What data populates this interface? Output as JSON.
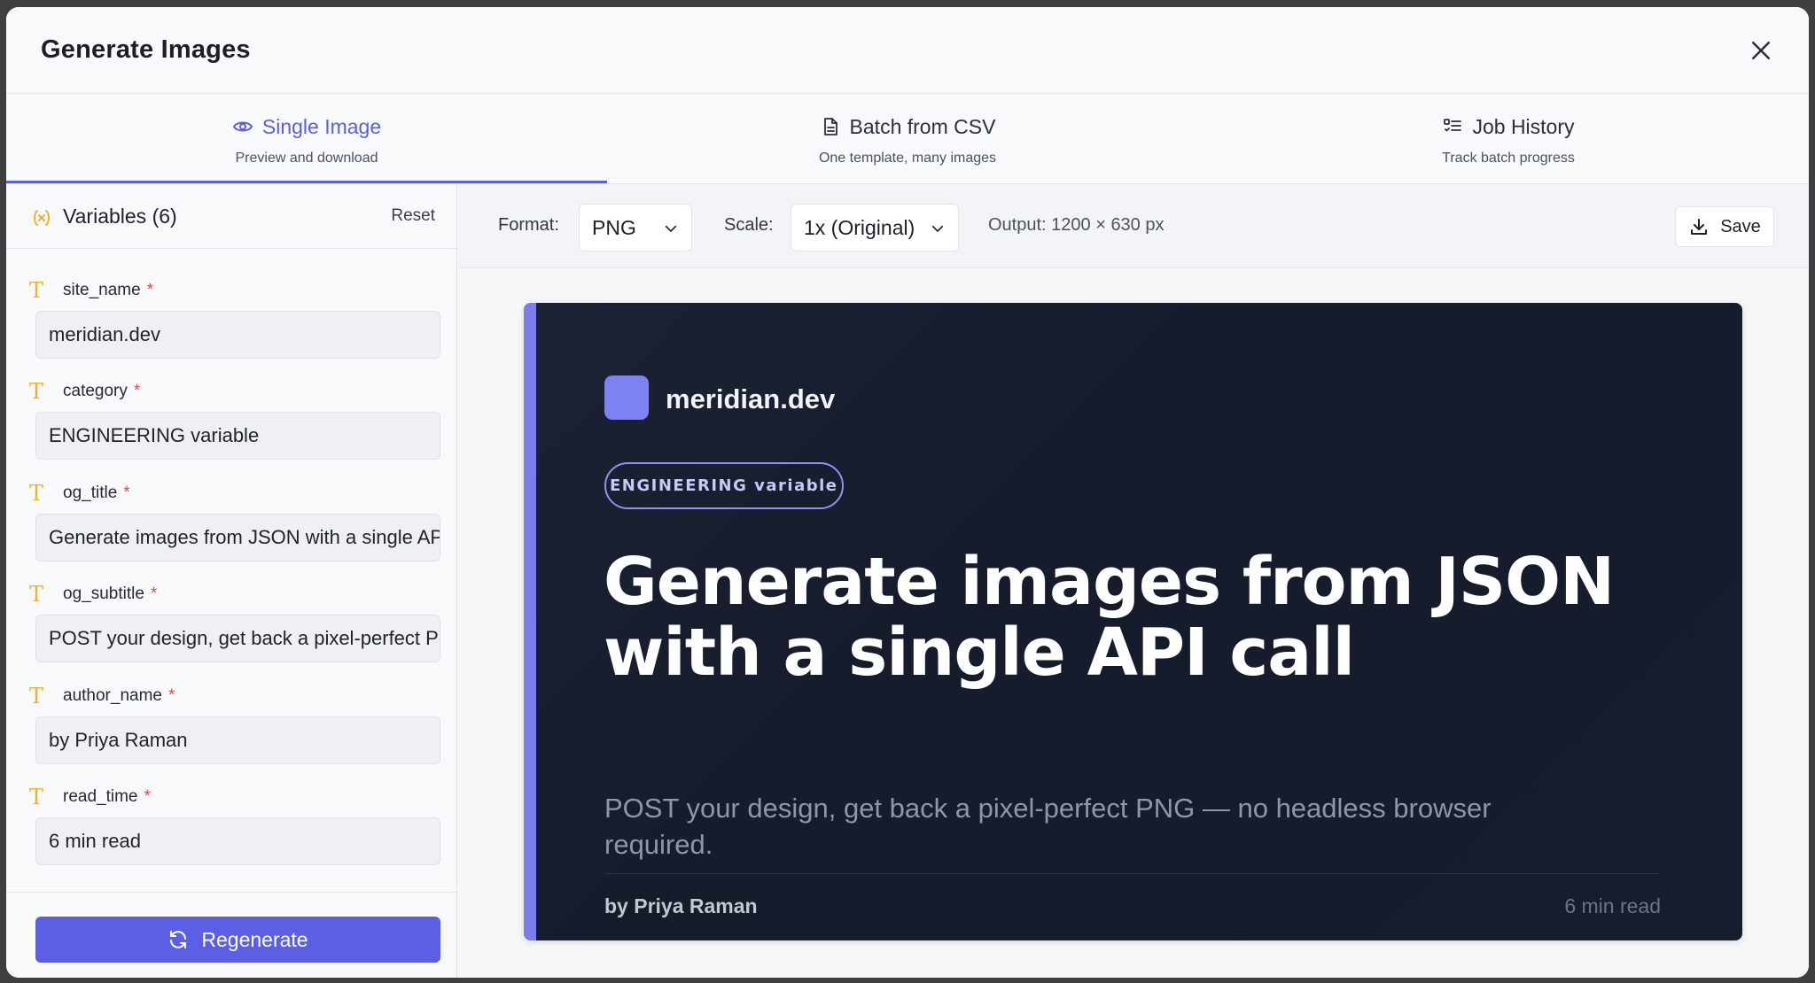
{
  "modal": {
    "title": "Generate Images"
  },
  "tabs": [
    {
      "label": "Single Image",
      "sub": "Preview and download",
      "icon": "eye-icon",
      "active": true
    },
    {
      "label": "Batch from CSV",
      "sub": "One template, many images",
      "icon": "file-icon",
      "active": false
    },
    {
      "label": "Job History",
      "sub": "Track batch progress",
      "icon": "list-checks-icon",
      "active": false
    }
  ],
  "sidebar": {
    "title": "Variables (6)",
    "reset_label": "Reset",
    "fields": [
      {
        "name": "site_name",
        "required": "*",
        "value": "meridian.dev"
      },
      {
        "name": "category",
        "required": "*",
        "value": "ENGINEERING variable"
      },
      {
        "name": "og_title",
        "required": "*",
        "value": "Generate images from JSON with a single API call"
      },
      {
        "name": "og_subtitle",
        "required": "*",
        "value": "POST your design, get back a pixel-perfect PNG — no headless browser required."
      },
      {
        "name": "author_name",
        "required": "*",
        "value": "by Priya Raman"
      },
      {
        "name": "read_time",
        "required": "*",
        "value": "6 min read"
      }
    ],
    "regenerate_label": "Regenerate"
  },
  "toolbar": {
    "format_label": "Format:",
    "format_value": "PNG",
    "scale_label": "Scale:",
    "scale_value": "1x (Original)",
    "output_text": "Output: 1200 × 630 px",
    "save_label": "Save"
  },
  "preview": {
    "site": "meridian.dev",
    "badge": "ENGINEERING variable",
    "title": "Generate images from JSON with a single API call",
    "subtitle": "POST your design, get back a pixel-perfect PNG — no headless browser required.",
    "author": "by Priya Raman",
    "read_time": "6 min read"
  },
  "colors": {
    "accent": "#5b5fe4",
    "required": "#e44b4b",
    "type_icon": "#f0b030",
    "card_bg": "#171d2d",
    "card_accent": "#7a7ee9"
  }
}
